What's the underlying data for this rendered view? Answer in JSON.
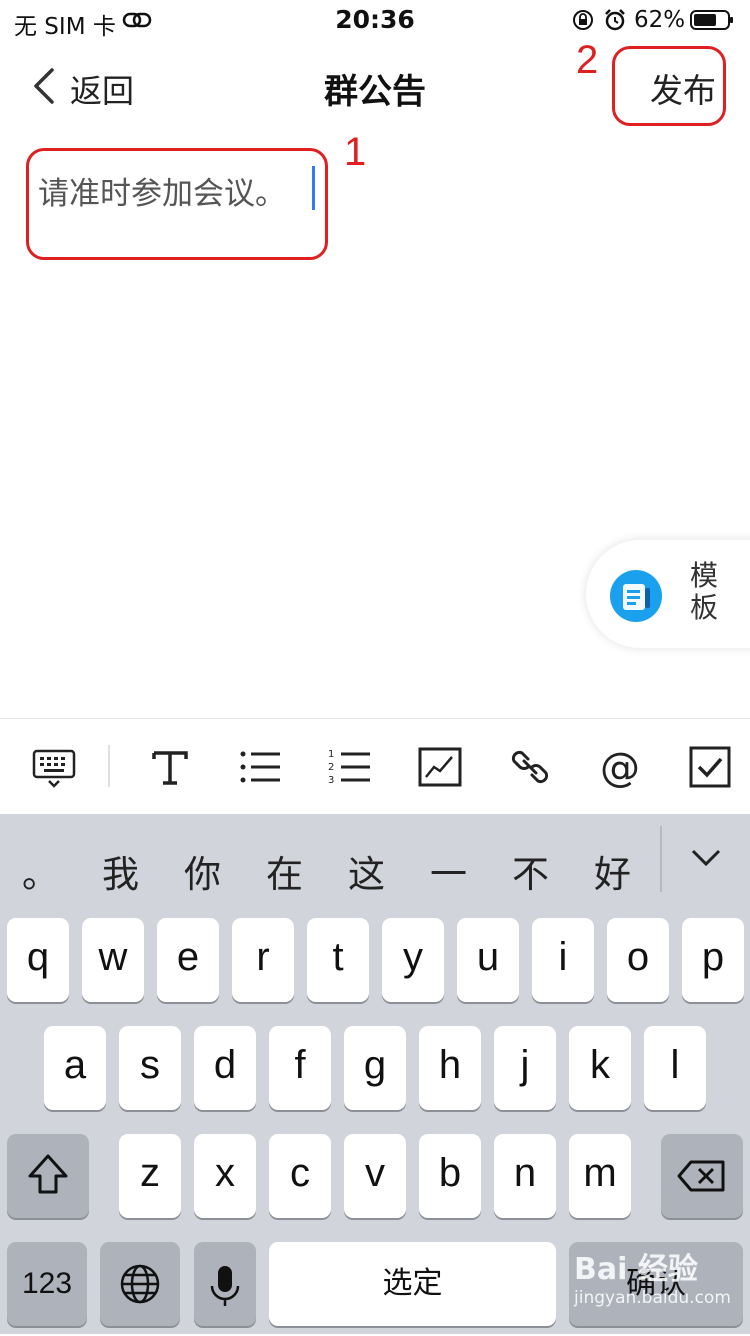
{
  "status_bar": {
    "carrier": "无 SIM 卡",
    "time": "20:36",
    "battery": "62%"
  },
  "nav": {
    "back_label": "返回",
    "title": "群公告",
    "publish_label": "发布"
  },
  "annotations": {
    "label_1": "1",
    "label_2": "2"
  },
  "editor": {
    "text": "请准时参加会议。"
  },
  "template_button": {
    "label": "模板"
  },
  "toolbar": {
    "icons": [
      "keyboard-icon",
      "text-format-icon",
      "bullet-list-icon",
      "numbered-list-icon",
      "chart-icon",
      "link-icon",
      "mention-icon",
      "checkbox-icon"
    ]
  },
  "keyboard": {
    "candidates": [
      "。",
      "我",
      "你",
      "在",
      "这",
      "一",
      "不",
      "好"
    ],
    "row1": [
      "q",
      "w",
      "e",
      "r",
      "t",
      "y",
      "u",
      "i",
      "o",
      "p"
    ],
    "row2": [
      "a",
      "s",
      "d",
      "f",
      "g",
      "h",
      "j",
      "k",
      "l"
    ],
    "row3": [
      "z",
      "x",
      "c",
      "v",
      "b",
      "n",
      "m"
    ],
    "numbers_key": "123",
    "space_key": "选定",
    "confirm_key": "确认"
  },
  "watermark": {
    "brand": "Bai 经验",
    "url": "jingyan.baidu.com"
  },
  "colors": {
    "annotation_red": "#e02020",
    "caret_blue": "#3478f6",
    "template_icon_blue": "#1aa0ec",
    "keyboard_bg": "#d1d4da"
  }
}
